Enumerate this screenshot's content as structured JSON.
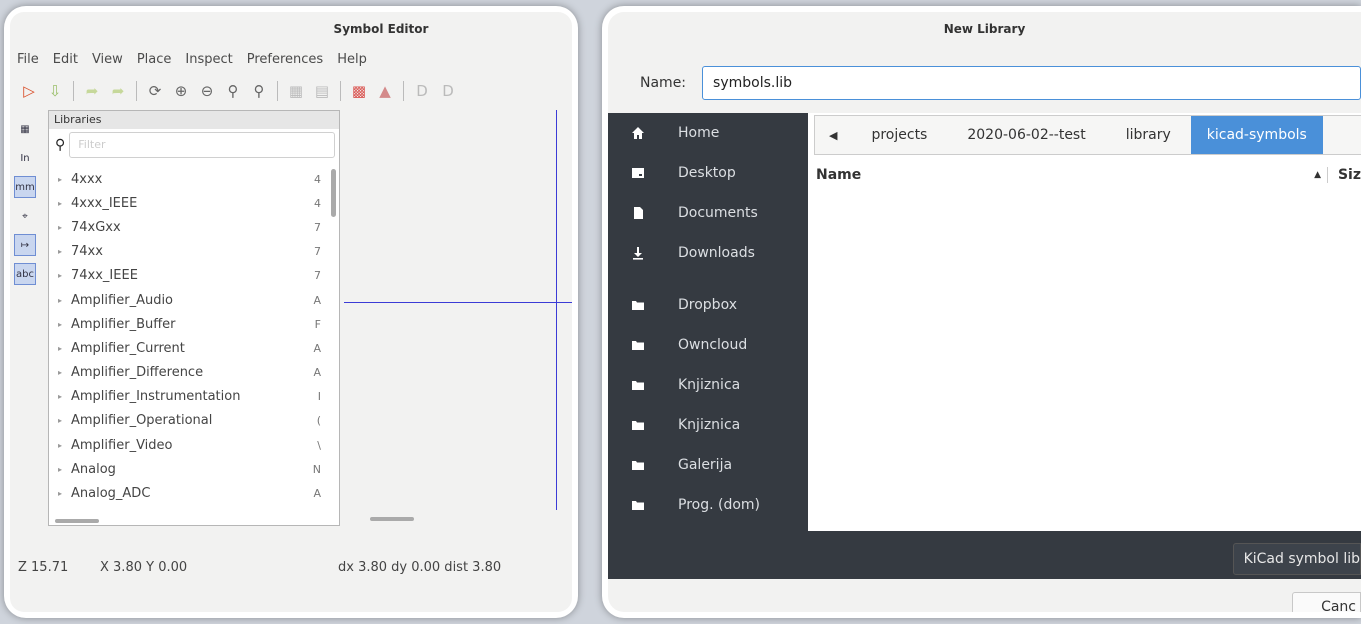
{
  "symbol_editor": {
    "title": "Symbol Editor",
    "menu": [
      "File",
      "Edit",
      "View",
      "Place",
      "Inspect",
      "Preferences",
      "Help"
    ],
    "libraries_header": "Libraries",
    "filter_placeholder": "Filter",
    "libraries": [
      {
        "name": "4xxx",
        "desc": "4"
      },
      {
        "name": "4xxx_IEEE",
        "desc": "4"
      },
      {
        "name": "74xGxx",
        "desc": "7"
      },
      {
        "name": "74xx",
        "desc": "7"
      },
      {
        "name": "74xx_IEEE",
        "desc": "7"
      },
      {
        "name": "Amplifier_Audio",
        "desc": "A"
      },
      {
        "name": "Amplifier_Buffer",
        "desc": "F"
      },
      {
        "name": "Amplifier_Current",
        "desc": "A"
      },
      {
        "name": "Amplifier_Difference",
        "desc": "A"
      },
      {
        "name": "Amplifier_Instrumentation",
        "desc": "I"
      },
      {
        "name": "Amplifier_Operational",
        "desc": "("
      },
      {
        "name": "Amplifier_Video",
        "desc": "\\"
      },
      {
        "name": "Analog",
        "desc": "N"
      },
      {
        "name": "Analog_ADC",
        "desc": "A"
      }
    ],
    "left_tools": [
      "In",
      "mm",
      "abc"
    ],
    "status": {
      "zoom": "Z 15.71",
      "xy": "X 3.80  Y 0.00",
      "delta": "dx 3.80  dy 0.00  dist 3.80"
    }
  },
  "new_library_dialog": {
    "title": "New Library",
    "name_label": "Name:",
    "name_value": "symbols.lib",
    "places": [
      {
        "label": "Home",
        "icon": "home-icon"
      },
      {
        "label": "Desktop",
        "icon": "desktop-icon"
      },
      {
        "label": "Documents",
        "icon": "document-icon"
      },
      {
        "label": "Downloads",
        "icon": "download-icon"
      },
      {
        "label": "Dropbox",
        "icon": "folder-icon"
      },
      {
        "label": "Owncloud",
        "icon": "folder-icon"
      },
      {
        "label": "Knjiznica",
        "icon": "folder-icon"
      },
      {
        "label": "Knjiznica",
        "icon": "folder-icon"
      },
      {
        "label": "Galerija",
        "icon": "folder-icon"
      },
      {
        "label": "Prog. (dom)",
        "icon": "folder-icon"
      }
    ],
    "breadcrumbs": [
      "projects",
      "2020-06-02--test",
      "library",
      "kicad-symbols"
    ],
    "columns": {
      "name": "Name",
      "size": "Siz"
    },
    "file_type": "KiCad symbol lib",
    "cancel": "Canc"
  },
  "colors": {
    "accent": "#4a90d9",
    "sidebar": "#353a41",
    "canvas_axis": "#3b3bd6"
  }
}
